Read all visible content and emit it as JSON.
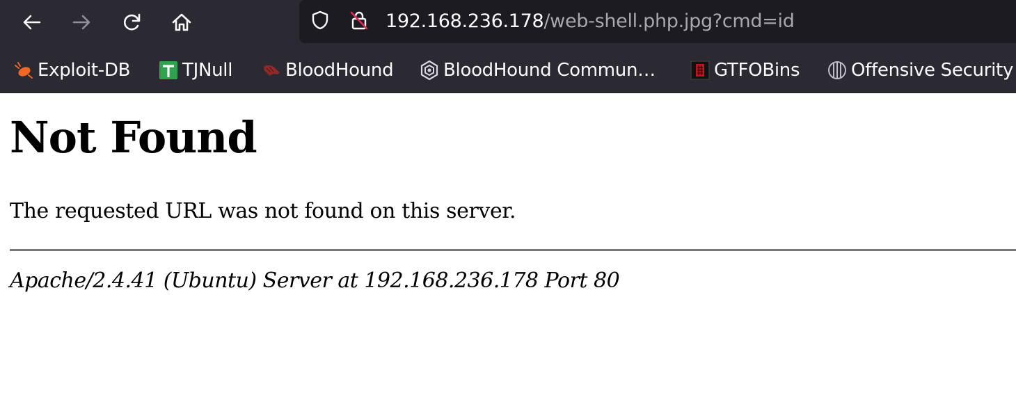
{
  "browser": {
    "url_host": "192.168.236.178",
    "url_path": "/web-shell.php.jpg?cmd=id",
    "icons": {
      "back": "arrow-left-icon",
      "forward": "arrow-right-icon",
      "reload": "reload-icon",
      "home": "home-icon",
      "tracking_protection": "shield-icon",
      "insecure_connection": "insecure-lock-icon"
    }
  },
  "bookmarks": [
    {
      "label": "Exploit-DB",
      "icon": "exploit-db-icon"
    },
    {
      "label": "TJNull",
      "icon": "tjnull-icon"
    },
    {
      "label": "BloodHound",
      "icon": "bloodhound-icon"
    },
    {
      "label": "BloodHound Commun…",
      "icon": "bloodhound-community-icon"
    },
    {
      "label": "GTFOBins",
      "icon": "gtfobins-icon"
    },
    {
      "label": "Offensive Security",
      "icon": "offensive-security-icon"
    }
  ],
  "page": {
    "title": "Not Found",
    "message": "The requested URL was not found on this server.",
    "server_signature": "Apache/2.4.41 (Ubuntu) Server at 192.168.236.178 Port 80"
  }
}
